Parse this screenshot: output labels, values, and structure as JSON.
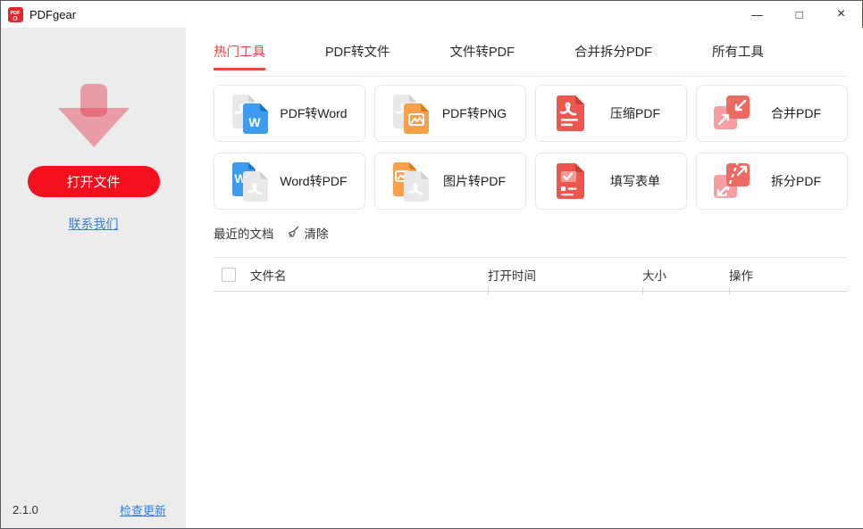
{
  "window": {
    "title": "PDFgear",
    "controls": {
      "minimize": "—",
      "maximize": "□",
      "close": "×"
    }
  },
  "sidebar": {
    "open_button": "打开文件",
    "contact_link": "联系我们"
  },
  "footer": {
    "version": "2.1.0",
    "check_update": "检查更新"
  },
  "tabs": {
    "items": [
      {
        "label": "热门工具",
        "active": true
      },
      {
        "label": "PDF转文件",
        "active": false
      },
      {
        "label": "文件转PDF",
        "active": false
      },
      {
        "label": "合并拆分PDF",
        "active": false
      },
      {
        "label": "所有工具",
        "active": false
      }
    ]
  },
  "tools": {
    "items": [
      {
        "label": "PDF转Word",
        "icon": "pdf-to-word-icon"
      },
      {
        "label": "PDF转PNG",
        "icon": "pdf-to-png-icon"
      },
      {
        "label": "压缩PDF",
        "icon": "compress-pdf-icon"
      },
      {
        "label": "合并PDF",
        "icon": "merge-pdf-icon"
      },
      {
        "label": "Word转PDF",
        "icon": "word-to-pdf-icon"
      },
      {
        "label": "图片转PDF",
        "icon": "image-to-pdf-icon"
      },
      {
        "label": "填写表单",
        "icon": "fill-form-icon"
      },
      {
        "label": "拆分PDF",
        "icon": "split-pdf-icon"
      }
    ]
  },
  "recent": {
    "title": "最近的文档",
    "clear_label": "清除",
    "clear_icon": "broom-icon"
  },
  "table": {
    "columns": [
      "文件名",
      "打开时间",
      "大小",
      "操作"
    ],
    "rows": []
  },
  "colors": {
    "brand_red": "#f2101d",
    "tab_active_red": "#e8473f",
    "link_blue": "#3a7fd9",
    "sidebar_gray": "#ececec",
    "icon_blue": "#3d9cf0",
    "icon_orange": "#f8a04c",
    "icon_red": "#ee564e",
    "icon_pink": "#f59fa3"
  }
}
